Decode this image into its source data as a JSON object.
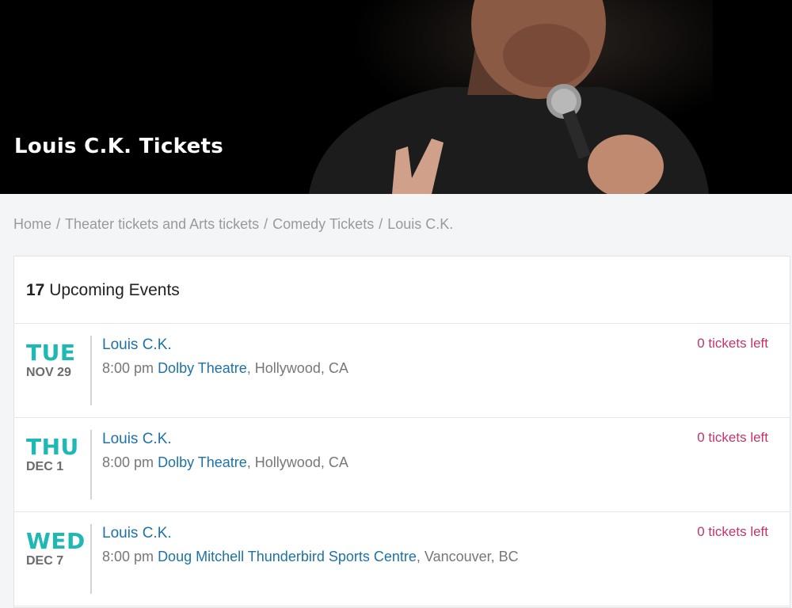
{
  "hero": {
    "title": "Louis C.K. Tickets"
  },
  "breadcrumb": {
    "items": [
      "Home",
      "Theater tickets and Arts tickets",
      "Comedy Tickets",
      "Louis C.K."
    ],
    "separator": "/"
  },
  "events_panel": {
    "count": "17",
    "count_label": "Upcoming Events",
    "events": [
      {
        "dow": "TUE",
        "date": "NOV 29",
        "name": "Louis C.K.",
        "time": "8:00 pm",
        "venue": "Dolby Theatre",
        "location": ", Hollywood, CA",
        "tickets_left": "0 tickets left"
      },
      {
        "dow": "THU",
        "date": "DEC 1",
        "name": "Louis C.K.",
        "time": "8:00 pm",
        "venue": "Dolby Theatre",
        "location": ", Hollywood, CA",
        "tickets_left": "0 tickets left"
      },
      {
        "dow": "WED",
        "date": "DEC 7",
        "name": "Louis C.K.",
        "time": "8:00 pm",
        "venue": "Doug Mitchell Thunderbird Sports Centre",
        "location": ", Vancouver, BC",
        "tickets_left": "0 tickets left"
      }
    ]
  },
  "colors": {
    "accent_teal": "#1eb8b5",
    "link_blue": "#1d72a8",
    "tickets_left": "#c2346a"
  }
}
